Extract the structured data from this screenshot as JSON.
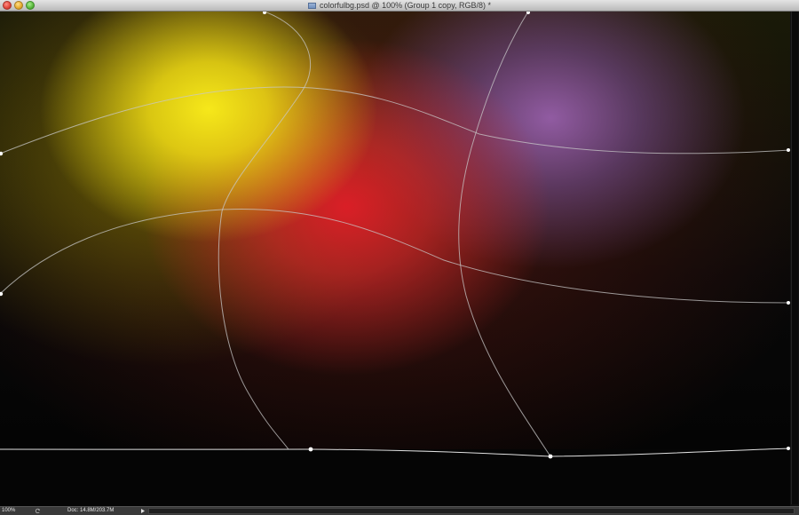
{
  "window": {
    "title": "colorfulbg.psd @ 100% (Group 1 copy, RGB/8) *",
    "doc_icon": "psd-document-icon"
  },
  "status": {
    "zoom": "100%",
    "doc_info": "Doc: 14.8M/203.7M"
  },
  "colors": {
    "yellow": "#f5e41a",
    "red": "#e02028",
    "purple": "#9660aa",
    "background": "#050505"
  }
}
